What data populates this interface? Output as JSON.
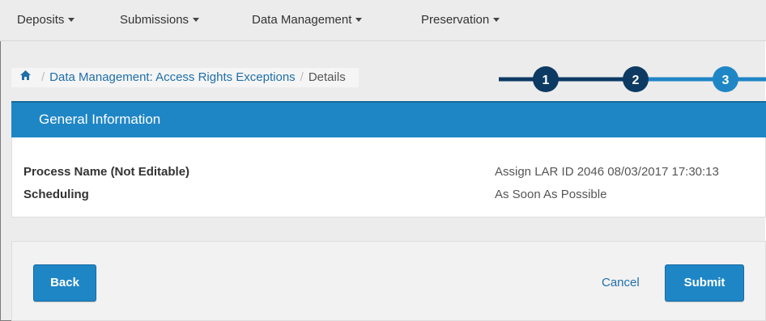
{
  "nav": {
    "items": [
      {
        "label": "Deposits"
      },
      {
        "label": "Submissions"
      },
      {
        "label": "Data Management"
      },
      {
        "label": "Preservation"
      }
    ]
  },
  "breadcrumb": {
    "home_icon": "home-icon",
    "link": "Data Management: Access Rights Exceptions",
    "current": "Details"
  },
  "stepper": {
    "steps": [
      "1",
      "2",
      "3"
    ],
    "colors": {
      "done": "#0d3a63",
      "active": "#1f86c6"
    }
  },
  "panel": {
    "title": "General Information",
    "fields": [
      {
        "label": "Process Name (Not Editable)",
        "value": "Assign LAR ID 2046 08/03/2017 17:30:13"
      },
      {
        "label": "Scheduling",
        "value": "As Soon As Possible"
      }
    ]
  },
  "footer": {
    "back_label": "Back",
    "cancel_label": "Cancel",
    "submit_label": "Submit"
  },
  "colors": {
    "accent": "#1f86c6",
    "link": "#1f6fa9",
    "step_dark": "#0d3a63"
  }
}
